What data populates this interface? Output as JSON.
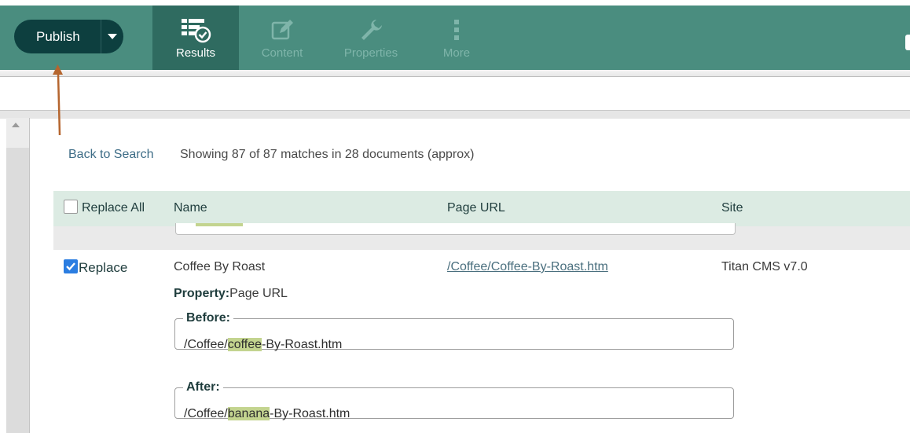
{
  "toolbar": {
    "publish_label": "Publish",
    "tabs": [
      {
        "label": "Results",
        "icon": "results-check-icon",
        "active": true
      },
      {
        "label": "Content",
        "icon": "edit-icon",
        "active": false
      },
      {
        "label": "Properties",
        "icon": "wrench-icon",
        "active": false
      },
      {
        "label": "More",
        "icon": "vertical-dots-icon",
        "active": false
      }
    ]
  },
  "search": {
    "back_label": "Back to Search",
    "summary": "Showing 87 of 87 matches in 28 documents (approx)"
  },
  "table": {
    "headers": {
      "replace_all": "Replace All",
      "name": "Name",
      "page_url": "Page URL",
      "site": "Site"
    },
    "row": {
      "replace_label": "Replace",
      "replace_checked": true,
      "name": "Coffee By Roast",
      "page_url": "/Coffee/Coffee-By-Roast.htm",
      "site": "Titan CMS v7.0",
      "property_key": "Property:",
      "property_value": "Page URL",
      "before_legend": "Before:",
      "before_prefix": "/Coffee/",
      "before_match": "coffee",
      "before_suffix": "-By-Roast.htm",
      "after_legend": "After:",
      "after_prefix": "/Coffee/",
      "after_match": "banana",
      "after_suffix": "-By-Roast.htm"
    }
  },
  "colors": {
    "toolbar": "#4a8d7f",
    "active_tab": "#2f6b60",
    "publish": "#0d3f3f",
    "header_row": "#dcebe3",
    "highlight": "#c3d48f",
    "annotation_arrow": "#b5652e"
  }
}
